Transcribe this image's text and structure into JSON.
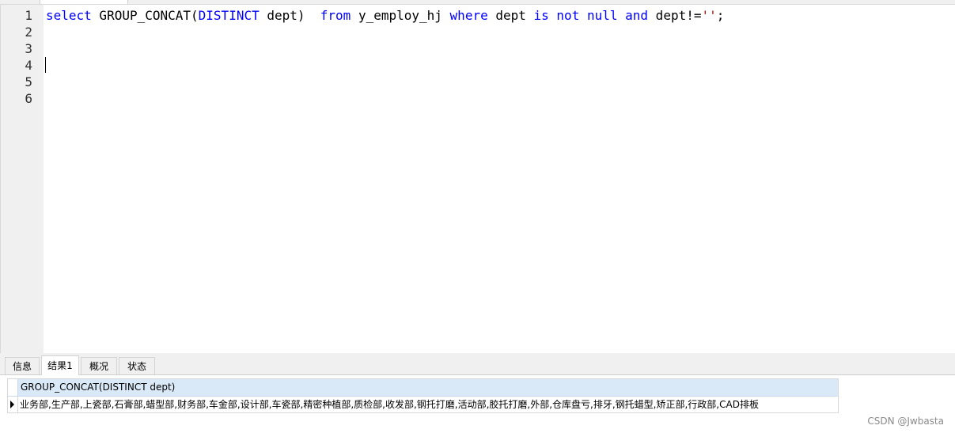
{
  "editor": {
    "line_numbers": [
      "1",
      "2",
      "3",
      "4",
      "5",
      "6"
    ],
    "query": {
      "kw_select": "select",
      "fn": " GROUP_CONCAT(",
      "kw_distinct": "DISTINCT",
      "col": " dept)  ",
      "kw_from": "from",
      "table": " y_employ_hj ",
      "kw_where": "where",
      "col2": " dept ",
      "kw_is": "is",
      "sp1": " ",
      "kw_not": "not",
      "sp2": " ",
      "kw_null": "null",
      "sp3": " ",
      "kw_and": "and",
      "tail": " dept!=",
      "str": "''",
      "semi": ";"
    }
  },
  "tabs": [
    {
      "label": "信息"
    },
    {
      "label": "结果1"
    },
    {
      "label": "概况"
    },
    {
      "label": "状态"
    }
  ],
  "results": {
    "column_header": "GROUP_CONCAT(DISTINCT dept)",
    "rows": [
      "业务部,生产部,上瓷部,石膏部,蜡型部,财务部,车金部,设计部,车瓷部,精密种植部,质检部,收发部,钢托打磨,活动部,胶托打磨,外部,仓库盘亏,排牙,钢托蜡型,矫正部,行政部,CAD排板"
    ]
  },
  "watermark": "CSDN @Jwbasta",
  "colors": {
    "keyword": "#0000ff",
    "string": "#a31515",
    "header_bg": "#dae9f7",
    "gutter_bg": "#f0f0f0"
  }
}
